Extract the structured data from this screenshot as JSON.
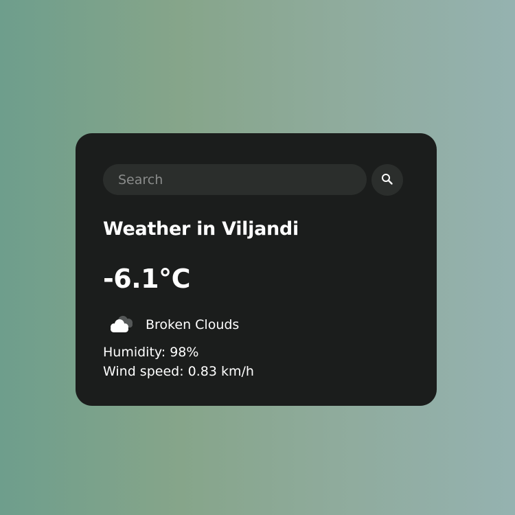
{
  "search": {
    "placeholder": "Search",
    "value": "",
    "button_icon": "search-icon"
  },
  "weather": {
    "title": "Weather in Viljandi",
    "temperature": "-6.1°C",
    "condition": "Broken Clouds",
    "condition_icon": "broken-clouds-icon",
    "humidity": "Humidity: 98%",
    "wind_speed": "Wind speed: 0.83 km/h"
  },
  "colors": {
    "card_background": "#1b1d1c",
    "input_background": "#2b2e2c",
    "text": "#ffffff",
    "placeholder": "#8a8c8b"
  }
}
